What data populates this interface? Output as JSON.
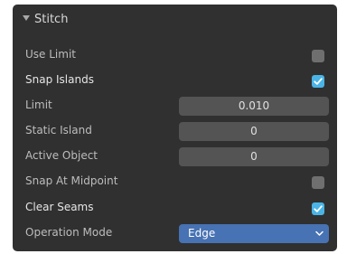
{
  "panel": {
    "title": "Stitch",
    "collapse_icon": "disclosure-triangle-down"
  },
  "options": {
    "use_limit": {
      "label": "Use Limit",
      "checked": false
    },
    "snap_islands": {
      "label": "Snap Islands",
      "checked": true
    },
    "limit": {
      "label": "Limit",
      "value": "0.010"
    },
    "static_island": {
      "label": "Static Island",
      "value": "0"
    },
    "active_object": {
      "label": "Active Object",
      "value": "0"
    },
    "snap_at_midpoint": {
      "label": "Snap At Midpoint",
      "checked": false
    },
    "clear_seams": {
      "label": "Clear Seams",
      "checked": true
    },
    "operation_mode": {
      "label": "Operation Mode",
      "value": "Edge"
    }
  },
  "colors": {
    "panel_bg": "#303030",
    "field_bg": "#545454",
    "checkbox_on": "#4bb4e6",
    "checkbox_off": "#6f6f6f",
    "select_bg": "#4772b3"
  }
}
